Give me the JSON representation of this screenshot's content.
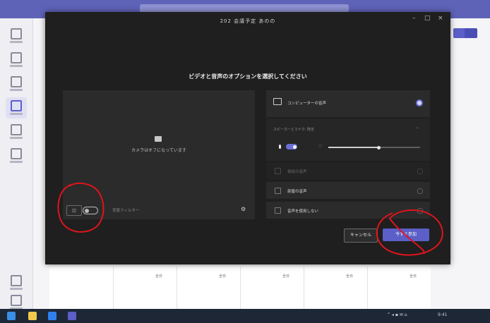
{
  "app": {
    "dialog_title": "202 会議予定 あのの",
    "window_controls": [
      "–",
      "□",
      "×"
    ]
  },
  "calendar": {
    "headers": [
      "全日",
      "全日",
      "全日",
      "全日",
      "全日"
    ]
  },
  "dialog": {
    "heading": "ビデオと音声のオプションを選択してください",
    "video": {
      "camera_off_text": "カメラはオフになっています",
      "background_button_label": "◫",
      "filter_placeholder": "背景フィルター"
    },
    "audio": {
      "computer_audio_label": "コンピューターの音声",
      "speaker_label": "スピーカーとマイク: 既定",
      "mic_volume_percent": 55,
      "phone_audio_label": "電話の音声",
      "room_audio_label": "部屋の音声",
      "no_audio_label": "音声を使用しない"
    },
    "buttons": {
      "cancel": "キャンセル",
      "join": "今すぐ参加"
    }
  },
  "taskbar": {
    "clock": "9:41"
  },
  "colors": {
    "accent": "#5b5fc7",
    "dialog_bg": "#1f1f1f",
    "annotation": "#e0141c"
  }
}
